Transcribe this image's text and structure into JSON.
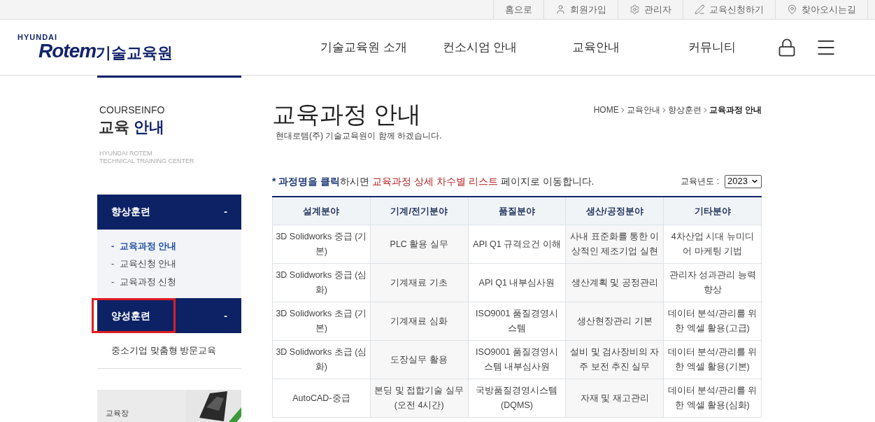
{
  "top_links": [
    {
      "label": "홈으로"
    },
    {
      "label": "회원가입"
    },
    {
      "label": "관리자"
    },
    {
      "label": "교육신청하기"
    },
    {
      "label": "찾아오시는길"
    }
  ],
  "logo": {
    "brand_top": "HYUNDAI",
    "brand": "Rotem",
    "suffix": "기술교육원"
  },
  "nav": [
    {
      "label": "기술교육원 소개"
    },
    {
      "label": "컨소시엄 안내"
    },
    {
      "label": "교육안내"
    },
    {
      "label": "커뮤니티"
    }
  ],
  "sidebar": {
    "eyebrow": "COURSEINFO",
    "title_a": "교육",
    "title_b": "안내",
    "subtitle_1": "HYUNDAI ROTEM",
    "subtitle_2": "TECHNICAL TRAINING CENTER",
    "groups": [
      {
        "label": "향상훈련",
        "toggle": "-",
        "highlighted": false,
        "kind": "submenu",
        "items": [
          {
            "bullet": "-",
            "label": "교육과정 안내",
            "selected": true
          },
          {
            "bullet": "-",
            "label": "교육신청 안내",
            "selected": false
          },
          {
            "bullet": "-",
            "label": "교육과정 신청",
            "selected": false
          }
        ]
      },
      {
        "label": "양성훈련",
        "toggle": "-",
        "highlighted": true,
        "kind": "links",
        "items": [
          {
            "label": "중소기업 맞춤형 방문교육",
            "selected": false
          }
        ]
      }
    ],
    "banner": {
      "caption": "교육장"
    }
  },
  "page": {
    "title": "교육과정 안내",
    "subtitle": "현대로템(주) 기술교육원이 함께 하겠습니다.",
    "breadcrumb": [
      {
        "label": "HOME",
        "current": false
      },
      {
        "label": "교육안내",
        "current": false
      },
      {
        "label": "향상훈련",
        "current": false
      },
      {
        "label": "교육과정 안내",
        "current": true
      }
    ],
    "notice": [
      {
        "kind": "emphasis",
        "text": "* 과정명을 클릭"
      },
      {
        "kind": "plain",
        "text": "하시면 "
      },
      {
        "kind": "highlight",
        "text": "교육과정 상세 차수별 리스트"
      },
      {
        "kind": "plain",
        "text": " 페이지로 이동합니다."
      }
    ],
    "year_label": "교육년도 :",
    "year": "2023"
  },
  "table": {
    "columns": [
      "설계분야",
      "기계/전기분야",
      "품질분야",
      "생산/공정분야",
      "기타분야"
    ],
    "rows": [
      [
        "3D Solidworks 중급 (기본)",
        "PLC 활용 실무",
        "API Q1 규격요건 이해",
        "사내 표준화를 통한 이상적인 제조기업 실현",
        "4차산업 시대 뉴미디어 마케팅 기법"
      ],
      [
        "3D Solidworks 중급 (심화)",
        "기계재료 기초",
        "API Q1 내부심사원",
        "생산계획 및 공정관리",
        "관리자 성과관리 능력 향상"
      ],
      [
        "3D Solidworks 초급 (기본)",
        "기계재료 심화",
        "ISO9001 품질경영시스템",
        "생산현장관리 기본",
        "데이터 분석/관리를 위한 엑셀 활용(고급)"
      ],
      [
        "3D Solidworks 초급 (심화)",
        "도장실무 활용",
        "ISO9001 품질경영시스템 내부심사원",
        "설비 및 검사장비의 자주 보전 추진 실무",
        "데이터 분석/관리를 위한 엑셀 활용(기본)"
      ],
      [
        "AutoCAD-중급",
        "본딩 및 접합기술 실무 (오전 4시간)",
        "국방품질경영시스템 (DQMS)",
        "자재 및 재고관리",
        "데이터 분석/관리를 위한 엑셀 활용(심화)"
      ]
    ]
  }
}
